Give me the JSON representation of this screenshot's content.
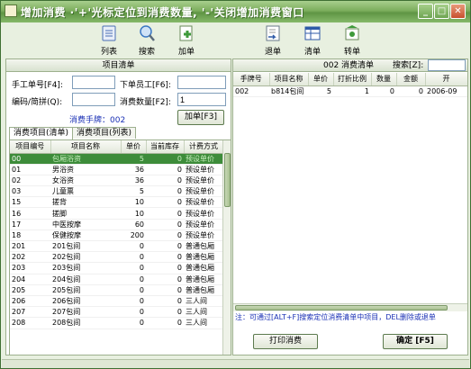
{
  "window": {
    "title": "增加消费 ·'+'光标定位到消费数量, '-'关闭增加消费窗口",
    "min_label": "_",
    "max_label": "□",
    "close_label": "✕"
  },
  "toolbar": {
    "items": [
      {
        "label": "列表",
        "icon": "list-icon",
        "color": "#4a6fb5"
      },
      {
        "label": "搜索",
        "icon": "search-icon",
        "color": "#3b78c4"
      },
      {
        "label": "加单",
        "icon": "add-doc-icon",
        "color": "#3e9a3a"
      },
      {
        "label": "退单",
        "icon": "return-icon",
        "color": "#2f5aa8"
      },
      {
        "label": "清单",
        "icon": "table-icon",
        "color": "#2f5aa8"
      },
      {
        "label": "转单",
        "icon": "transfer-icon",
        "color": "#3e9a3a"
      }
    ]
  },
  "left": {
    "header": "项目清单",
    "form": {
      "manual_no_label": "手工单号[F4]:",
      "manual_no_value": "",
      "staff_label": "下单员工[F6]:",
      "staff_value": "",
      "code_label": "编码/简拼(Q):",
      "code_value": "",
      "qty_label": "消费数量[F2]:",
      "qty_value": "1",
      "card_text": "消费手牌：002",
      "add_button": "加单[F3]"
    },
    "tabs": [
      "消费项目(清单)",
      "消费项目(列表)"
    ],
    "columns": [
      "项目编号",
      "项目名称",
      "单价",
      "当前库存",
      "计费方式"
    ],
    "rows": [
      {
        "code": "00",
        "name": "包厢浴资",
        "price": "5",
        "stock": "0",
        "mode": "预设单价"
      },
      {
        "code": "01",
        "name": "男浴资",
        "price": "36",
        "stock": "0",
        "mode": "预设单价"
      },
      {
        "code": "02",
        "name": "女浴资",
        "price": "36",
        "stock": "0",
        "mode": "预设单价"
      },
      {
        "code": "03",
        "name": "儿童票",
        "price": "5",
        "stock": "0",
        "mode": "预设单价"
      },
      {
        "code": "15",
        "name": "搓背",
        "price": "10",
        "stock": "0",
        "mode": "预设单价"
      },
      {
        "code": "16",
        "name": "搓脚",
        "price": "10",
        "stock": "0",
        "mode": "预设单价"
      },
      {
        "code": "17",
        "name": "中医按摩",
        "price": "60",
        "stock": "0",
        "mode": "预设单价"
      },
      {
        "code": "18",
        "name": "保健按摩",
        "price": "200",
        "stock": "0",
        "mode": "预设单价"
      },
      {
        "code": "201",
        "name": "201包间",
        "price": "0",
        "stock": "0",
        "mode": "普通包厢"
      },
      {
        "code": "202",
        "name": "202包间",
        "price": "0",
        "stock": "0",
        "mode": "普通包厢"
      },
      {
        "code": "203",
        "name": "203包间",
        "price": "0",
        "stock": "0",
        "mode": "普通包厢"
      },
      {
        "code": "204",
        "name": "204包间",
        "price": "0",
        "stock": "0",
        "mode": "普通包厢"
      },
      {
        "code": "205",
        "name": "205包间",
        "price": "0",
        "stock": "0",
        "mode": "普通包厢"
      },
      {
        "code": "206",
        "name": "206包间",
        "price": "0",
        "stock": "0",
        "mode": "三人间"
      },
      {
        "code": "207",
        "name": "207包间",
        "price": "0",
        "stock": "0",
        "mode": "三人间"
      },
      {
        "code": "208",
        "name": "208包间",
        "price": "0",
        "stock": "0",
        "mode": "三人间"
      }
    ]
  },
  "right": {
    "header": "002 消费清单",
    "search_label": "搜索[Z]:",
    "search_value": "",
    "columns": [
      "手牌号",
      "项目名称",
      "单价",
      "打折比例",
      "数量",
      "金额",
      "开"
    ],
    "rows": [
      {
        "card": "002",
        "name": "b814包间",
        "price": "5",
        "discount": "1",
        "qty": "0",
        "amount": "0",
        "time": "2006-09"
      }
    ],
    "note": "注：可通过[ALT+F]搜索定位消费清单中项目，DEL删除或退单",
    "print_button": "打印消费",
    "confirm_button": "确定 [F5]"
  }
}
